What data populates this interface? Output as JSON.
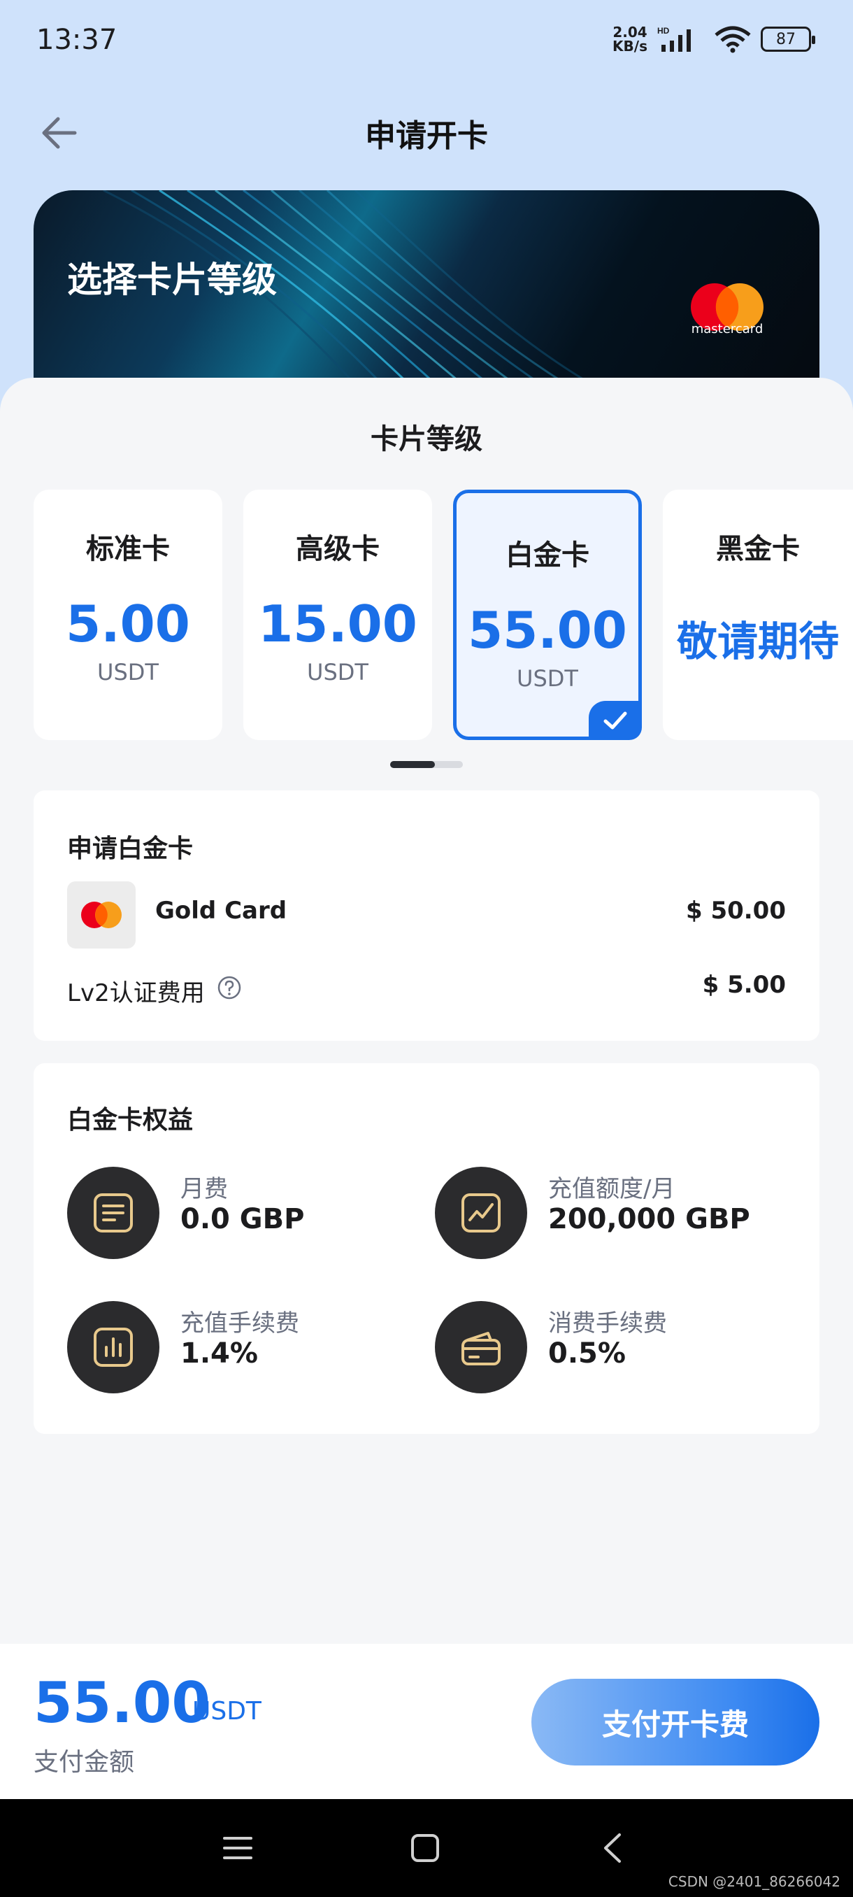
{
  "status_bar": {
    "time": "13:37",
    "net_speed_value": "2.04",
    "net_speed_unit": "KB/s",
    "battery": "87"
  },
  "header": {
    "title": "申请开卡"
  },
  "hero": {
    "title": "选择卡片等级",
    "brand": "mastercard"
  },
  "tier_section": {
    "title": "卡片等级",
    "tiers": [
      {
        "name": "标准卡",
        "price": "5.00",
        "unit": "USDT"
      },
      {
        "name": "高级卡",
        "price": "15.00",
        "unit": "USDT"
      },
      {
        "name": "白金卡",
        "price": "55.00",
        "unit": "USDT",
        "selected": true
      },
      {
        "name": "黑金卡",
        "status": "敬请期待"
      }
    ]
  },
  "apply": {
    "title": "申请白金卡",
    "card_name": "Gold Card",
    "card_price": "$ 50.00",
    "fee_label": "Lv2认证费用",
    "fee_value": "$ 5.00"
  },
  "benefits": {
    "title": "白金卡权益",
    "items": [
      {
        "label": "月费",
        "value": "0.0 GBP",
        "icon": "document-icon"
      },
      {
        "label": "充值额度/月",
        "value": "200,000 GBP",
        "icon": "trend-chart-icon"
      },
      {
        "label": "充值手续费",
        "value": "1.4%",
        "icon": "bar-chart-icon"
      },
      {
        "label": "消费手续费",
        "value": "0.5%",
        "icon": "wallet-card-icon"
      }
    ]
  },
  "payment": {
    "amount": "55.00",
    "unit": "USDT",
    "label": "支付金额",
    "button": "支付开卡费"
  },
  "watermark": "CSDN @2401_86266042",
  "colors": {
    "accent": "#1a6fe8",
    "header_bg": "#cfe2fb",
    "icon_bg": "#2b2b2d",
    "icon_gold": "#e8c98c"
  }
}
